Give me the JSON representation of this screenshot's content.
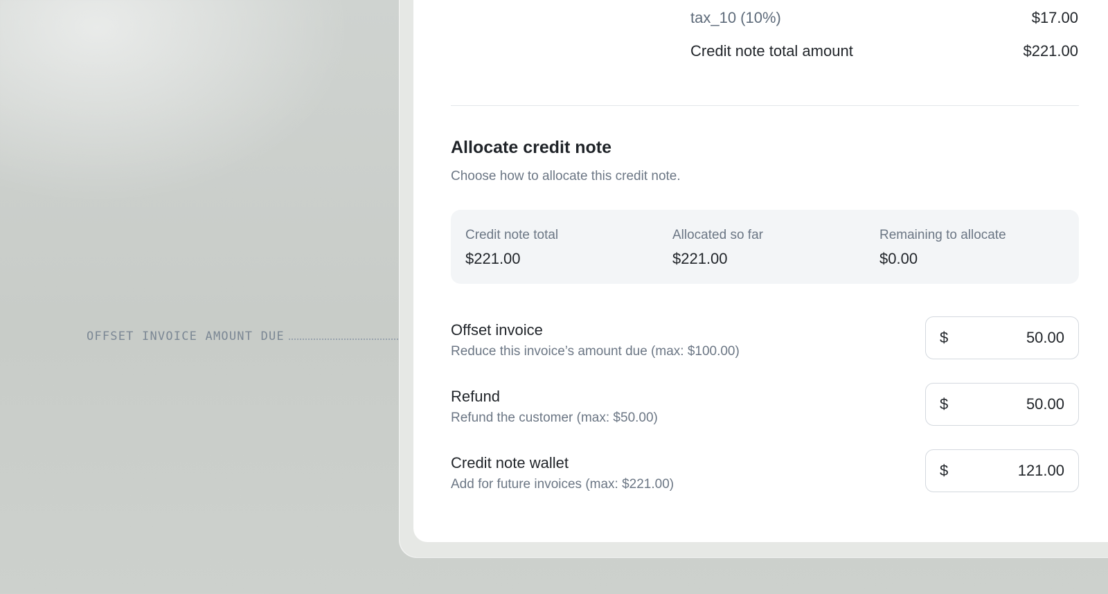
{
  "callout": {
    "text": "OFFSET INVOICE AMOUNT DUE"
  },
  "summary_lines": {
    "tax_label": "tax_10 (10%)",
    "tax_amount": "$17.00",
    "total_label": "Credit note total amount",
    "total_amount": "$221.00"
  },
  "allocate": {
    "title": "Allocate credit note",
    "subtitle": "Choose how to allocate this credit note.",
    "stats": {
      "total_label": "Credit note total",
      "total_value": "$221.00",
      "allocated_label": "Allocated so far",
      "allocated_value": "$221.00",
      "remaining_label": "Remaining to allocate",
      "remaining_value": "$0.00"
    },
    "rows": [
      {
        "title": "Offset invoice",
        "description": "Reduce this invoice’s amount due (max: $100.00)",
        "currency": "$",
        "value": "50.00"
      },
      {
        "title": "Refund",
        "description": "Refund the customer (max: $50.00)",
        "currency": "$",
        "value": "50.00"
      },
      {
        "title": "Credit note wallet",
        "description": "Add for future invoices (max: $221.00)",
        "currency": "$",
        "value": "121.00"
      }
    ]
  }
}
